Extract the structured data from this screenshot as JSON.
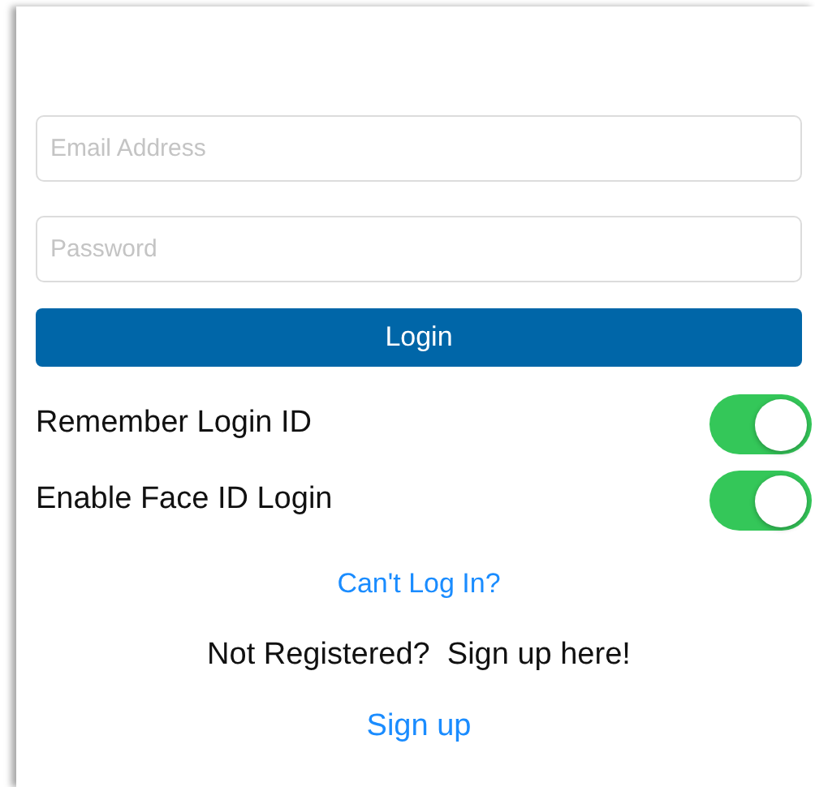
{
  "fields": [
    {
      "placeholder": "Email Address"
    },
    {
      "placeholder": "Password"
    }
  ],
  "login_button": "Login",
  "toggles": [
    {
      "label": "Remember Login ID",
      "on": true
    },
    {
      "label": "Enable Face ID Login",
      "on": true
    }
  ],
  "cant_log_in_link": "Can't Log In?",
  "register_prompt": "Not Registered?  Sign up here!",
  "sign_up_link": "Sign up"
}
